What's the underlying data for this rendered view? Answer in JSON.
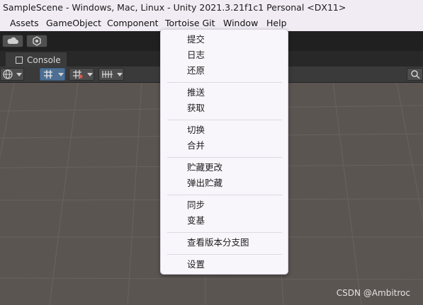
{
  "window": {
    "title": "SampleScene - Windows, Mac, Linux - Unity 2021.3.21f1c1 Personal <DX11>"
  },
  "menubar": {
    "items": [
      "Assets",
      "GameObject",
      "Component",
      "Tortoise Git",
      "Window",
      "Help"
    ]
  },
  "toolbar": {
    "cloud_icon": "cloud-icon",
    "collab_icon": "collab-icon"
  },
  "tabs": {
    "console_label": "Console"
  },
  "dropdown": {
    "groups": [
      [
        "提交",
        "日志",
        "还原"
      ],
      [
        "推送",
        "获取"
      ],
      [
        "切换",
        "合并"
      ],
      [
        "贮藏更改",
        "弹出贮藏"
      ],
      [
        "同步",
        "变基"
      ],
      [
        "查看版本分支图"
      ],
      [
        "设置"
      ]
    ]
  },
  "watermark": "CSDN @Ambitroc"
}
